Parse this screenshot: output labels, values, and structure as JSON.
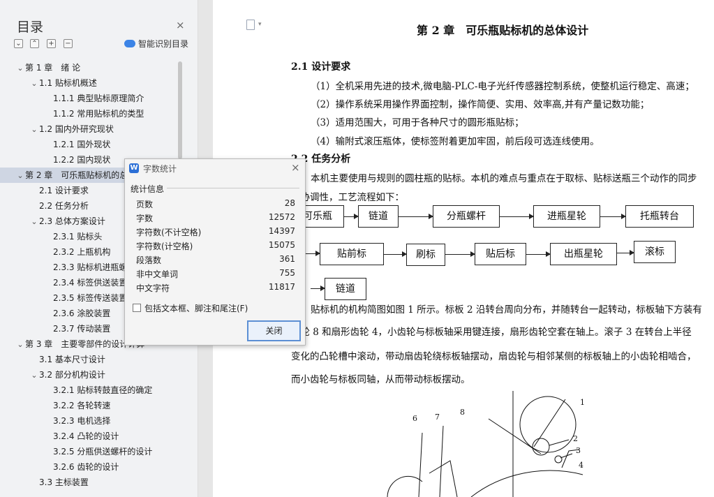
{
  "toc": {
    "title": "目录",
    "close": "×",
    "tools": [
      "⌄",
      "⌃",
      "+",
      "−"
    ],
    "smart": "智能识别目录",
    "items": [
      {
        "label": "第 1 章　绪  论",
        "level": 0,
        "chev": "⌄"
      },
      {
        "label": "1.1  贴标机概述",
        "level": 1,
        "chev": "⌄"
      },
      {
        "label": "1.1.1  典型贴标原理简介",
        "level": 2,
        "chev": ""
      },
      {
        "label": "1.1.2  常用贴标机的类型",
        "level": 2,
        "chev": ""
      },
      {
        "label": "1.2 国内外研究现状",
        "level": 1,
        "chev": "⌄"
      },
      {
        "label": "1.2.1 国外现状",
        "level": 2,
        "chev": ""
      },
      {
        "label": "1.2.2  国内现状",
        "level": 2,
        "chev": ""
      },
      {
        "label": "第 2 章　可乐瓶贴标机的总体设计",
        "level": 0,
        "chev": "⌄"
      },
      {
        "label": "2.1 设计要求",
        "level": 1,
        "chev": ""
      },
      {
        "label": "2.2 任务分析",
        "level": 1,
        "chev": ""
      },
      {
        "label": "2.3 总体方案设计",
        "level": 1,
        "chev": "⌄"
      },
      {
        "label": "2.3.1  贴标头",
        "level": 2,
        "chev": ""
      },
      {
        "label": "2.3.2  上瓶机构",
        "level": 2,
        "chev": ""
      },
      {
        "label": "2.3.3    贴标机进瓶螺杆",
        "level": 2,
        "chev": ""
      },
      {
        "label": "2.3.4 标签供送装置",
        "level": 2,
        "chev": ""
      },
      {
        "label": "2.3.5 标签传送装置",
        "level": 2,
        "chev": ""
      },
      {
        "label": "2.3.6 涂胶装置",
        "level": 2,
        "chev": ""
      },
      {
        "label": "2.3.7 传动装置",
        "level": 2,
        "chev": ""
      },
      {
        "label": "第 3 章　主要零部件的设计计算",
        "level": 0,
        "chev": "⌄"
      },
      {
        "label": "3.1  基本尺寸设计",
        "level": 1,
        "chev": ""
      },
      {
        "label": "3.2  部分机构设计",
        "level": 1,
        "chev": "⌄"
      },
      {
        "label": "3.2.1 贴标转鼓直径的确定",
        "level": 2,
        "chev": ""
      },
      {
        "label": "3.2.2 各轮转速",
        "level": 2,
        "chev": ""
      },
      {
        "label": "3.2.3 电机选择",
        "level": 2,
        "chev": ""
      },
      {
        "label": "3.2.4 凸轮的设计",
        "level": 2,
        "chev": ""
      },
      {
        "label": "3.2.5 分瓶供送螺杆的设计",
        "level": 2,
        "chev": ""
      },
      {
        "label": "3.2.6 齿轮的设计",
        "level": 2,
        "chev": ""
      },
      {
        "label": "3.3 主标装置",
        "level": 1,
        "chev": ""
      }
    ],
    "selected_index": 7
  },
  "page": {
    "chapter": "第 2 章　可乐瓶贴标机的总体设计",
    "s21": "2.1 设计要求",
    "req": [
      "（1）全机采用先进的技术,微电脑-PLC-电子光纤传感器控制系统，使整机运行稳定、高速；",
      "（2）操作系统采用操作界面控制，操作简便、实用、效率高,并有产量记数功能；",
      "（3）适用范围大，可用于各种尺寸的圆形瓶贴标；",
      "（4）输附式滚压瓶体，使标签附着更加牢固，前后段可选连线使用。"
    ],
    "s22": "2.2 任务分析",
    "t1": "本机主要使用与规则的圆柱瓶的贴标。本机的难点与重点在于取标、贴标送瓶三个动作的同步",
    "t2": "和协调性，工艺流程如下：",
    "flow": [
      "可乐瓶",
      "链道",
      "分瓶螺杆",
      "进瓶星轮",
      "托瓶转台",
      "贴前标",
      "刷标",
      "贴后标",
      "出瓶星轮",
      "滚标",
      "链道"
    ],
    "m1": "贴标机的机构简图如图 1 所示。标板 2 沿转台周向分布，并随转台一起转动，标板轴下方装有",
    "m2": "齿轮 8 和扇形齿轮 4，小齿轮与标板轴采用键连接，扇形齿轮空套在轴上。滚子 3 在转台上半径",
    "m3": "变化的凸轮槽中滚动，带动扇齿轮绕标板轴摆动，扇齿轮与相邻某侧的标板轴上的小齿轮相啮合，",
    "m4": "而小齿轮与标板同轴，从而带动标板摆动。",
    "fig_labels": [
      "1",
      "2",
      "3",
      "4",
      "6",
      "7",
      "8"
    ]
  },
  "dialog": {
    "icon": "W",
    "title": "字数统计",
    "close": "×",
    "section": "统计信息",
    "stats": [
      {
        "label": "页数",
        "value": "28"
      },
      {
        "label": "字数",
        "value": "12572"
      },
      {
        "label": "字符数(不计空格)",
        "value": "14397"
      },
      {
        "label": "字符数(计空格)",
        "value": "15075"
      },
      {
        "label": "段落数",
        "value": "361"
      },
      {
        "label": "非中文单词",
        "value": "755"
      },
      {
        "label": "中文字符",
        "value": "11817"
      }
    ],
    "checkbox_label": "包括文本框、脚注和尾注(F)",
    "checkbox_checked": false,
    "close_button": "关闭"
  }
}
